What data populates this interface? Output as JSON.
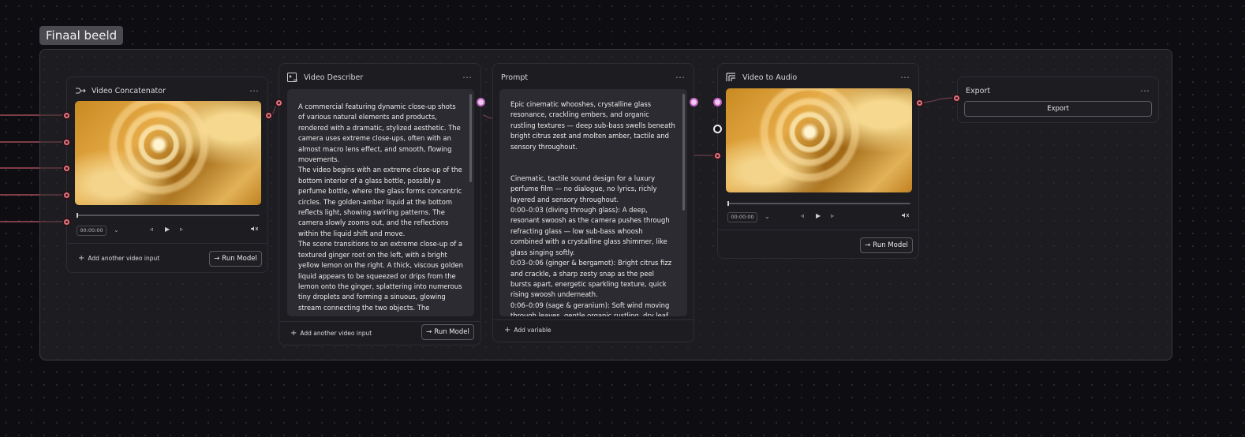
{
  "group": {
    "label": "Finaal beeld"
  },
  "nodes": {
    "concatenator": {
      "title": "Video Concatenator",
      "time": "00:00:00",
      "add_label": "Add another video input",
      "run_label": "Run Model"
    },
    "describer": {
      "title": "Video Describer",
      "text": "A commercial featuring dynamic close-up shots of various natural elements and products, rendered with a dramatic, stylized aesthetic. The camera uses extreme close-ups, often with an almost macro lens effect, and smooth, flowing movements.\nThe video begins with an extreme close-up of the bottom interior of a glass bottle, possibly a perfume bottle, where the glass forms concentric circles. The golden-amber liquid at the bottom reflects light, showing swirling patterns. The camera slowly zooms out, and the reflections within the liquid shift and move.\nThe scene transitions to an extreme close-up of a textured ginger root on the left, with a bright yellow lemon on the right. A thick, viscous golden liquid appears to be squeezed or drips from the lemon onto the ginger, splattering into numerous tiny droplets and forming a sinuous, glowing stream connecting the two objects. The",
      "add_label": "Add another video input",
      "run_label": "Run Model"
    },
    "prompt": {
      "title": "Prompt",
      "text": "Epic cinematic whooshes, crystalline glass resonance, crackling embers, and organic rustling textures — deep sub-bass swells beneath bright citrus zest and molten amber, tactile and sensory throughout.\n\n\nCinematic, tactile sound design for a luxury perfume film — no dialogue, no lyrics, richly layered and sensory throughout.\n0:00–0:03 (diving through glass): A deep, resonant swoosh as the camera pushes through refracting glass — low sub-bass whoosh combined with a crystalline glass shimmer, like glass singing softly.\n0:03–0:06 (ginger & bergamot): Bright citrus fizz and crackle, a sharp zesty snap as the peel bursts apart, energetic sparkling texture, quick rising swoosh underneath.\n0:06–0:09 (sage & geranium): Soft wind moving through leaves, gentle organic rustling, dry leaf",
      "add_label": "Add variable"
    },
    "video_audio": {
      "title": "Video to Audio",
      "time": "00:00:00",
      "run_label": "Run Model"
    },
    "export": {
      "title": "Export",
      "button_label": "Export"
    }
  },
  "icons": {
    "menu": "⋯",
    "arrow": "→",
    "plus": "+",
    "dropdown": "⌄",
    "prev": "◃",
    "play": "▶",
    "next": "▹",
    "volume": "🔇"
  },
  "colors": {
    "background": "#0e0e12",
    "node": "#1c1c21",
    "handle_red": "#e5727e",
    "handle_purple": "#c065c4",
    "wire": "#d06470"
  }
}
